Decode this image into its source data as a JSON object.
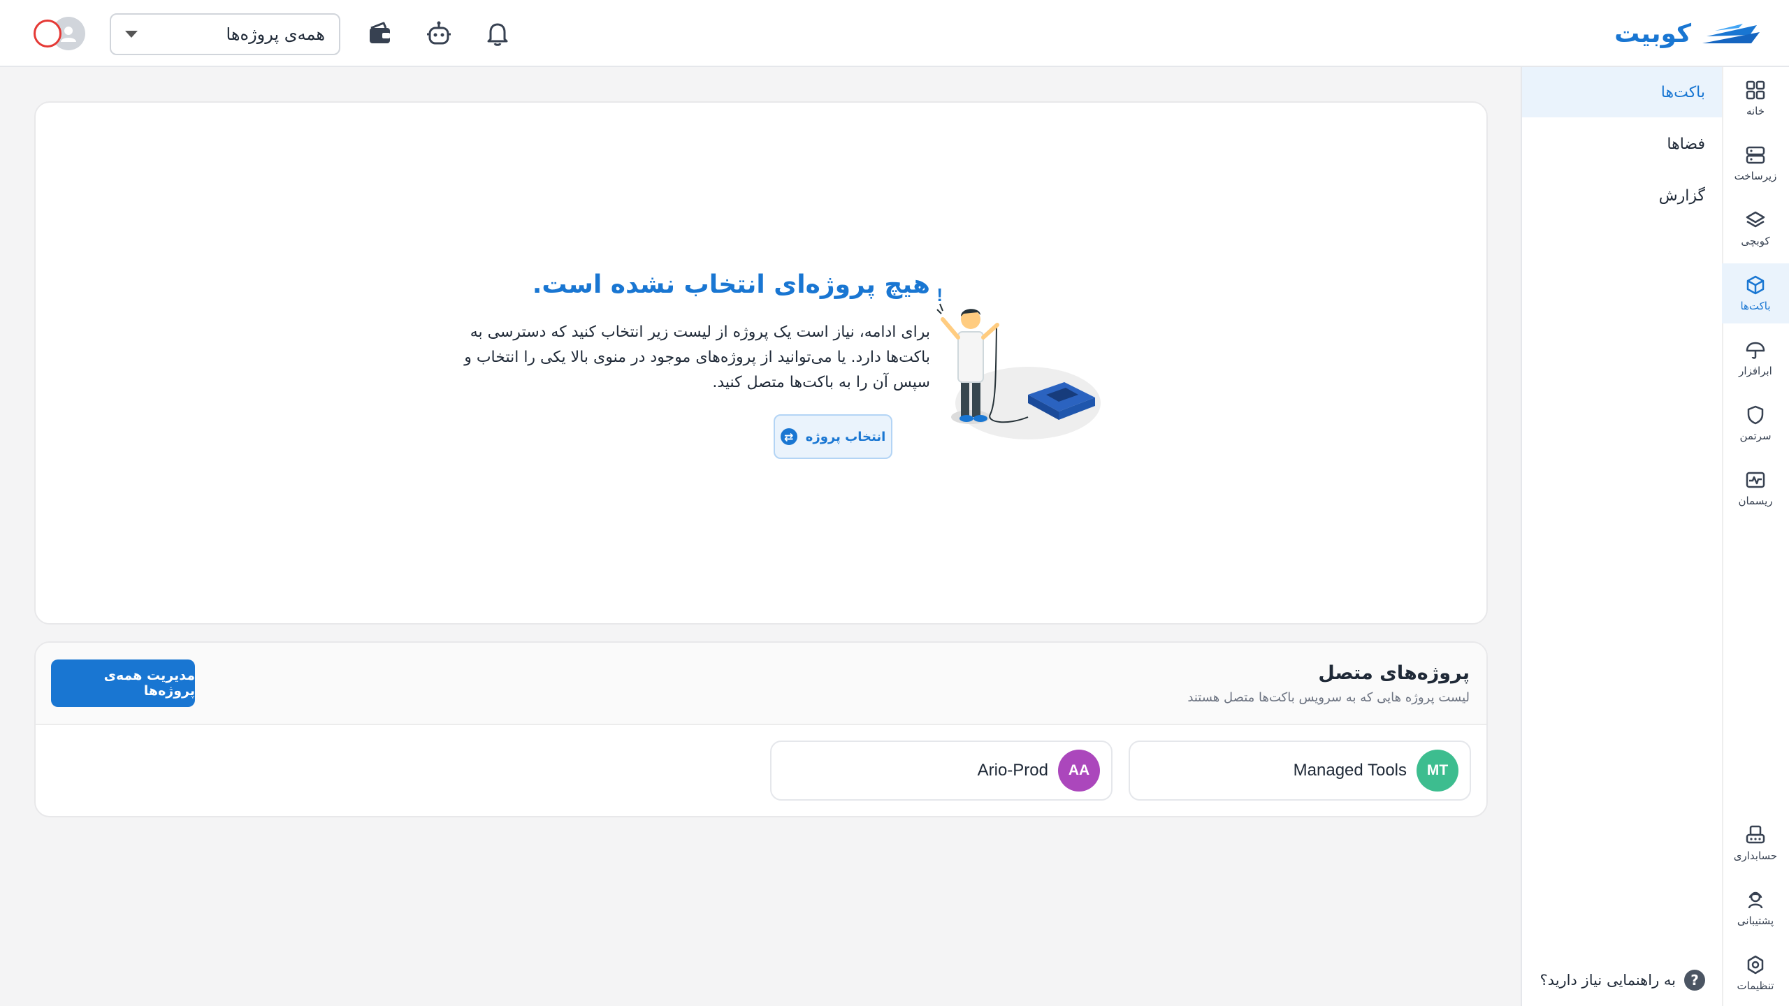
{
  "app": {
    "logo_text": "کوبیت"
  },
  "topbar": {
    "project_select_value": "همه‌ی پروژه‌ها"
  },
  "rail": {
    "items": [
      {
        "label": "خانه",
        "icon": "grid-icon"
      },
      {
        "label": "زیرساخت",
        "icon": "server-icon"
      },
      {
        "label": "کوبچی",
        "icon": "layers-icon"
      },
      {
        "label": "باکت‌ها",
        "icon": "cube-icon",
        "active": true
      },
      {
        "label": "ابرافزار",
        "icon": "umbrella-icon"
      },
      {
        "label": "سرتمن",
        "icon": "shield-icon"
      },
      {
        "label": "ریسمان",
        "icon": "pulse-icon"
      }
    ],
    "bottom_items": [
      {
        "label": "حسابداری",
        "icon": "accounting-icon"
      },
      {
        "label": "پشتیبانی",
        "icon": "support-icon"
      },
      {
        "label": "تنظیمات",
        "icon": "settings-icon"
      }
    ]
  },
  "subnav": {
    "items": [
      {
        "label": "باکت‌ها",
        "active": true
      },
      {
        "label": "فضاها"
      },
      {
        "label": "گزارش"
      }
    ],
    "help": "به راهنمایی نیاز دارید؟"
  },
  "empty_state": {
    "title": "هیچ پروژه‌ای انتخاب نشده است.",
    "description": "برای ادامه، نیاز است یک پروژه از لیست زیر انتخاب کنید که دسترسی به باکت‌ها دارد. یا می‌توانید از پروژه‌های موجود در منوی بالا یکی را انتخاب و سپس آن را به باکت‌ها متصل کنید.",
    "button": "انتخاب پروژه"
  },
  "connected_projects": {
    "title": "پروژه‌های متصل",
    "subtitle": "لیست پروژه هایی که به سرویس باکت‌ها متصل هستند",
    "manage_button": "مدیریت همه‌ی پروژه‌ها",
    "projects": [
      {
        "initials": "MT",
        "name": "Managed Tools",
        "color": "#3dbd8f"
      },
      {
        "initials": "AA",
        "name": "Ario-Prod",
        "color": "#ab47bc"
      }
    ]
  },
  "colors": {
    "primary": "#1976d2",
    "active_bg": "#eaf3fc"
  }
}
